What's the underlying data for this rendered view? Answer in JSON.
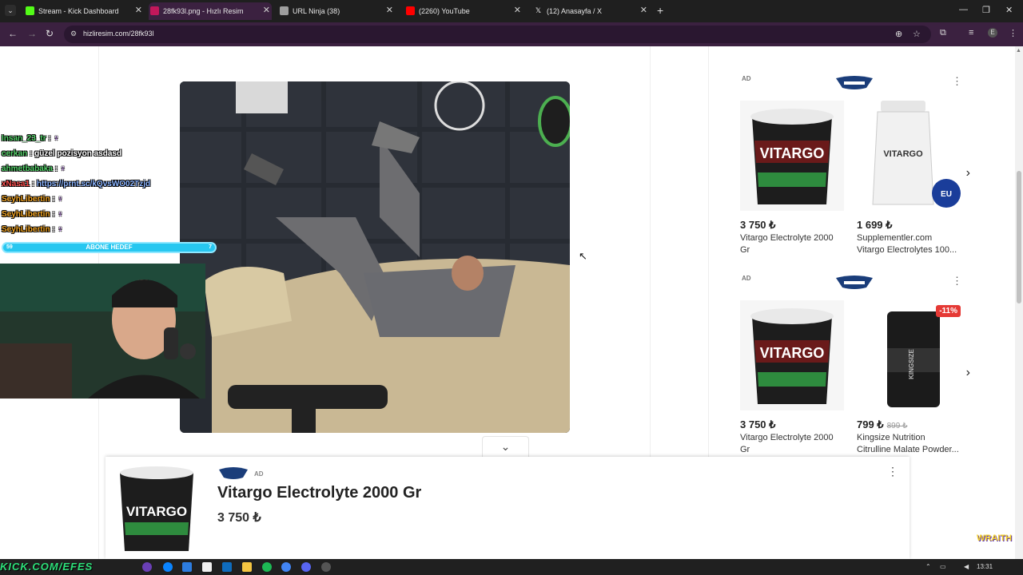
{
  "browser": {
    "tabs": [
      {
        "title": "Stream - Kick Dashboard",
        "color": "#53fc18"
      },
      {
        "title": "28fk93l.png - Hızlı Resim",
        "color": "#c2185b"
      },
      {
        "title": "URL Ninja (38)",
        "color": "#9e9e9e"
      },
      {
        "title": "(2260) YouTube",
        "color": "#ff0000"
      },
      {
        "title": "(12) Anasayfa / X",
        "color": "#ffffff"
      }
    ],
    "url": "hizliresim.com/28fk93l"
  },
  "chat": {
    "lines": [
      {
        "user": "Insan_23_tr",
        "sep": " : ",
        "msg": "♀",
        "link": ""
      },
      {
        "user": "cerkan",
        "sep": " : ",
        "msg": "güzel pozisyon asdasd",
        "link": ""
      },
      {
        "user": "ahmetbabaka",
        "sep": " : ",
        "msg": "♀",
        "link": ""
      },
      {
        "user": "xNasa1",
        "sep": " : ",
        "msg": "",
        "link": "https://prnt.sc/kQvsWO02Tzjd"
      },
      {
        "user": "SeyhLibertin",
        "sep": " : ",
        "msg": "♀",
        "link": ""
      },
      {
        "user": "SeyhLibertin",
        "sep": " : ",
        "msg": "♀",
        "link": ""
      },
      {
        "user": "SeyhLibertin",
        "sep": " : ",
        "msg": "♀",
        "link": ""
      }
    ],
    "goal": {
      "label": "ABONE HEDEF",
      "current": "59",
      "target": "7"
    }
  },
  "ads": [
    {
      "label": "AD",
      "products": [
        {
          "price": "3 750 ₺",
          "old_price": "",
          "name1": "Vitargo Electrolyte 2000",
          "name2": "Gr",
          "brand": "VITARGO",
          "badge": ""
        },
        {
          "price": "1 699 ₺",
          "old_price": "",
          "name1": "Supplementler.com",
          "name2": "Vitargo Electrolytes 100...",
          "brand": "VITARGO",
          "badge": ""
        }
      ]
    },
    {
      "label": "AD",
      "products": [
        {
          "price": "3 750 ₺",
          "old_price": "",
          "name1": "Vitargo Electrolyte 2000",
          "name2": "Gr",
          "brand": "VITARGO",
          "badge": ""
        },
        {
          "price": "799 ₺",
          "old_price": "899 ₺",
          "name1": "Kingsize Nutrition",
          "name2": "Citrulline Malate Powder...",
          "brand": "KINGSIZE",
          "badge": "-11%"
        }
      ]
    }
  ],
  "banner": {
    "label": "AD",
    "title": "Vitargo Electrolyte 2000 Gr",
    "price": "3 750 ₺"
  },
  "overlay": {
    "efes": "KICK.COM/EFES",
    "wraith": "WRAITH"
  },
  "taskbar": {
    "time": "13:31"
  }
}
